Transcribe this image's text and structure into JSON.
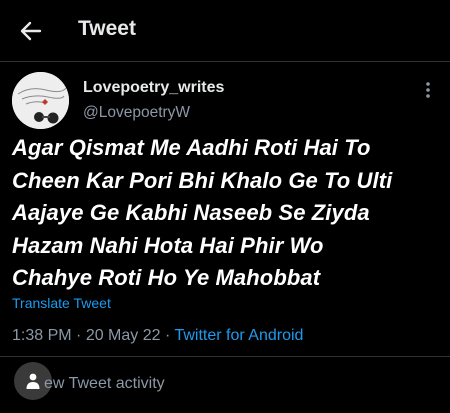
{
  "header": {
    "title": "Tweet",
    "back_icon": "arrow-left-icon"
  },
  "author": {
    "name": "Lovepoetry_writes",
    "handle": "@LovepoetryW"
  },
  "tweet": {
    "text": "Agar Qismat Me Aadhi Roti Hai To\nCheen Kar Pori Bhi Khalo Ge To Ulti\nAajaye Ge Kabhi Naseeb Se Ziyda\nHazam Nahi Hota Hai Phir Wo\nChahye Roti Ho Ye Mahobbat",
    "translate_label": "Translate Tweet",
    "time": "1:38 PM",
    "separator": " · ",
    "date": "20 May 22",
    "source": "Twitter for Android"
  },
  "activity": {
    "label": "ew Tweet activity"
  },
  "colors": {
    "accent": "#1d9bf0",
    "muted": "#8b98a5",
    "background": "#000000"
  }
}
